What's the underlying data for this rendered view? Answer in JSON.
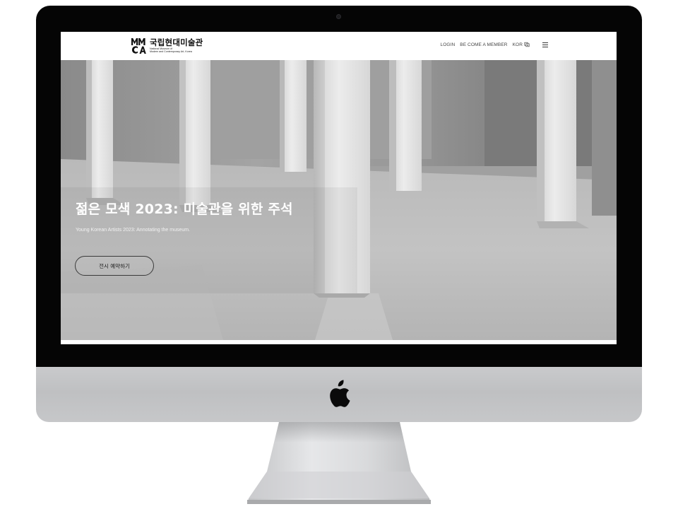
{
  "site": {
    "logo": {
      "korean_name": "국립현대미술관",
      "english_line1": "National Museum of",
      "english_line2": "Modern and Contemporary Art, Korea"
    },
    "nav": {
      "login": "LOGIN",
      "member": "BE COME A MEMBER",
      "language": "KOR",
      "language_icon": "globe-icon",
      "menu_icon": "hamburger-menu-icon"
    }
  },
  "hero": {
    "title": "젊은 모색 2023: 미술관을 위한 주석",
    "subtitle": "Young Korean Artists 2023: Annotating the museum.",
    "button_label": "전시 예약하기"
  },
  "device": {
    "logo_icon": "apple-logo-icon",
    "bezel_color": "#050505",
    "chin_color": "#c4c5c7"
  }
}
